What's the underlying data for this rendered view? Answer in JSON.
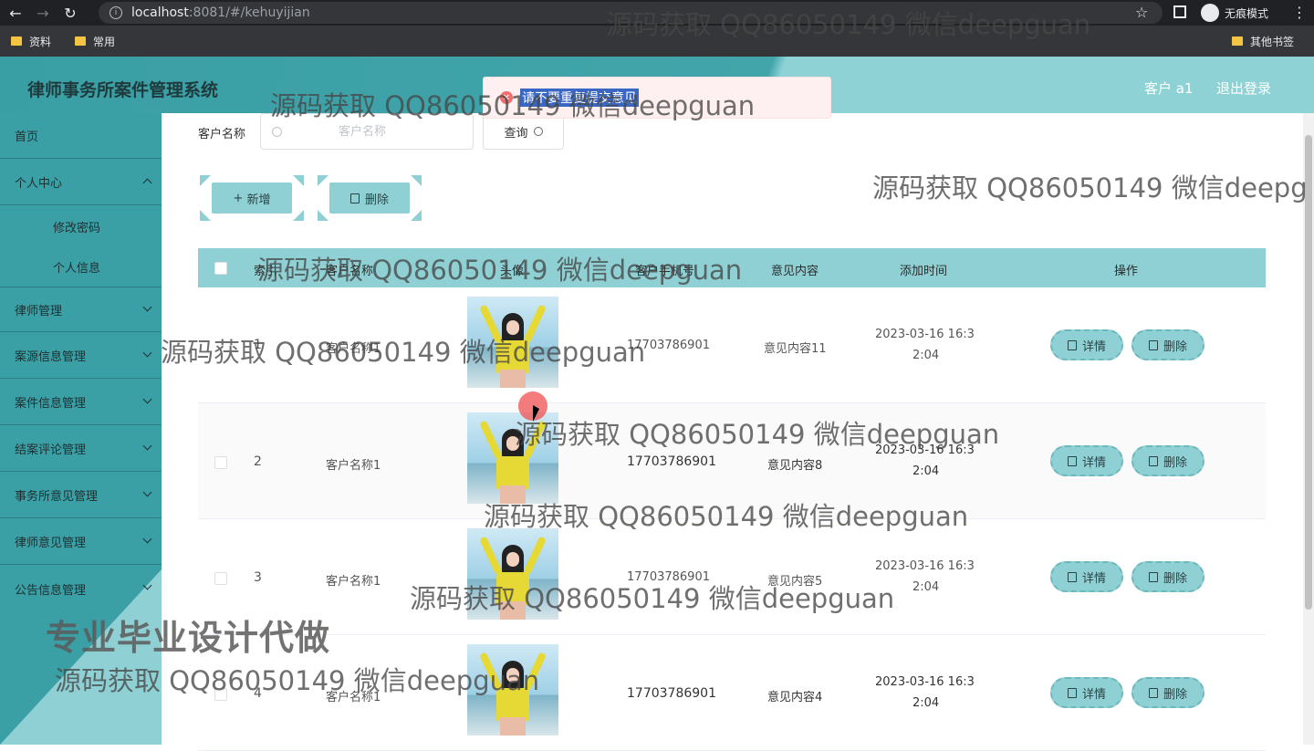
{
  "browser": {
    "url_host": "localhost",
    "url_path": ":8081/#/kehuyijian",
    "incognito_label": "无痕模式",
    "bookmarks": [
      "资料",
      "常用"
    ],
    "other_bookmarks": "其他书签"
  },
  "header": {
    "title": "律师事务所案件管理系统",
    "user": "客户 a1",
    "logout": "退出登录"
  },
  "toast": {
    "message": "请不要重复提交意见"
  },
  "sidebar": {
    "items": [
      {
        "label": "首页"
      },
      {
        "label": "个人中心"
      },
      {
        "label": "修改密码"
      },
      {
        "label": "个人信息"
      },
      {
        "label": "律师管理"
      },
      {
        "label": "案源信息管理"
      },
      {
        "label": "案件信息管理"
      },
      {
        "label": "结案评论管理"
      },
      {
        "label": "事务所意见管理"
      },
      {
        "label": "律师意见管理"
      },
      {
        "label": "公告信息管理"
      }
    ]
  },
  "search": {
    "label": "客户名称",
    "placeholder": "客户名称",
    "button": "查询"
  },
  "actions": {
    "add": "新增",
    "delete": "删除"
  },
  "table": {
    "headers": [
      "索引",
      "客户名称",
      "头像",
      "客户手机号",
      "意见内容",
      "添加时间",
      "操作"
    ],
    "rows": [
      {
        "index": "1",
        "name": "客户名称1",
        "phone": "17703786901",
        "content": "意见内容11",
        "time_l1": "2023-03-16 16:3",
        "time_l2": "2:04"
      },
      {
        "index": "2",
        "name": "客户名称1",
        "phone": "17703786901",
        "content": "意见内容8",
        "time_l1": "2023-03-16 16:3",
        "time_l2": "2:04"
      },
      {
        "index": "3",
        "name": "客户名称1",
        "phone": "17703786901",
        "content": "意见内容5",
        "time_l1": "2023-03-16 16:3",
        "time_l2": "2:04"
      },
      {
        "index": "4",
        "name": "客户名称1",
        "phone": "17703786901",
        "content": "意见内容4",
        "time_l1": "2023-03-16 16:3",
        "time_l2": "2:04"
      }
    ],
    "detail_label": "详情",
    "delete_label": "删除"
  },
  "watermark": {
    "text": "源码获取 QQ86050149 微信deepguan",
    "text_cut": "源码获取 QQ86050149 微信deepg",
    "big": "专业毕业设计代做"
  }
}
